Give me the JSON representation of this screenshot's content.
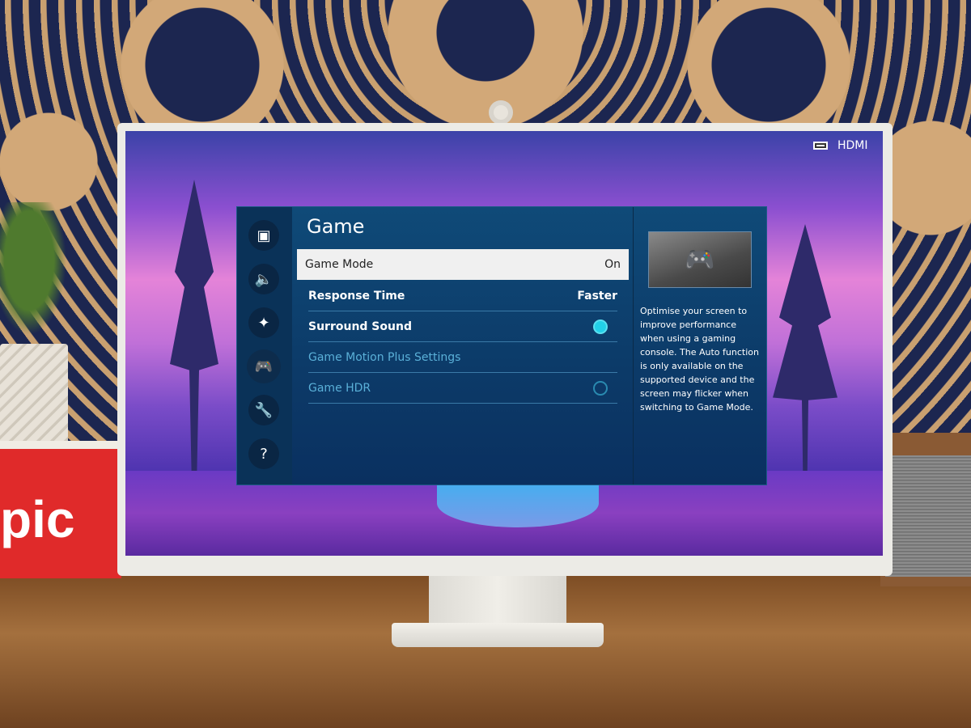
{
  "source": {
    "icon": "hdmi-icon",
    "label": "HDMI"
  },
  "menu": {
    "title": "Game",
    "sidebar": [
      {
        "icon": "picture-icon",
        "active": false
      },
      {
        "icon": "sound-icon",
        "active": false
      },
      {
        "icon": "connection-icon",
        "active": false
      },
      {
        "icon": "gamepad-icon",
        "active": true
      },
      {
        "icon": "wrench-icon",
        "active": false
      },
      {
        "icon": "support-icon",
        "active": false
      }
    ],
    "items": [
      {
        "label": "Game Mode",
        "value": "On",
        "selected": true
      },
      {
        "label": "Response Time",
        "value": "Faster"
      },
      {
        "label": "Surround Sound",
        "toggle": "on"
      },
      {
        "label": "Game Motion Plus Settings",
        "disabled": true
      },
      {
        "label": "Game HDR",
        "toggle": "off",
        "disabled": true
      }
    ],
    "info": {
      "preview_icon": "gamepad-icon",
      "description": "Optimise your screen to improve performance when using a gaming console. The Auto function is only available on the supported device and the screen may flicker when switching to Game Mode."
    }
  },
  "colors": {
    "accent": "#22d0e8",
    "panel": "#0c3a68",
    "selected_row": "#f0f0f0"
  },
  "box_lettering": "pic"
}
